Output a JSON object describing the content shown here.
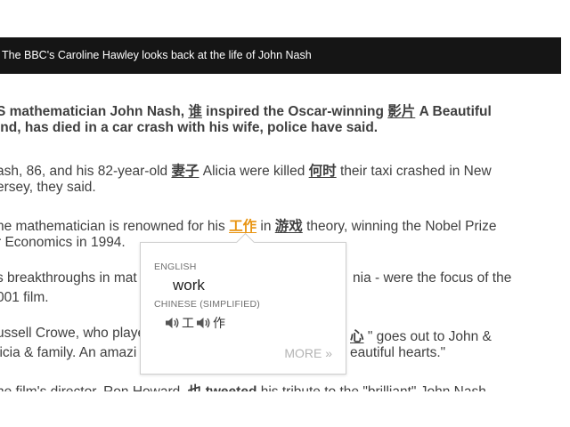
{
  "caption": "The BBC's Caroline Hawley looks back at the life of John Nash",
  "article": {
    "lead_line1": [
      "S mathematician John Nash, ",
      "谁",
      " inspired the Oscar-winning ",
      "影片",
      " A Beautiful"
    ],
    "lead_line2": "ind, has died in a car crash with his wife, police have said.",
    "p1_line1": [
      "ash, 86, and his 82-year-old ",
      "妻子",
      " Alicia were killed ",
      "何时",
      " their taxi crashed in New"
    ],
    "p1_line2": "ersey, they said.",
    "p2_line1": [
      "ne mathematician is renowned for his ",
      "工作",
      " in ",
      "游戏",
      " theory, winning the Nobel Prize"
    ],
    "p2_line2": "r Economics in 1994.",
    "p3_line1_left": "s breakthroughs in mat",
    "p3_line1_right": "nia - were the focus of the",
    "p3_line2": "001 film.",
    "p4_line1_left": "ussell Crowe, who playe",
    "p4_line1_vocab": "心",
    "p4_line1_right": " \" goes out to John &",
    "p4_line2_left": "licia & family. An amazi",
    "p4_line2_right": "eautiful hearts.\"",
    "p5_line1": [
      "he film's director, Ron Howard, ",
      "也",
      " ",
      "tweeted",
      " his tribute to the \"brilliant\" John Nash."
    ]
  },
  "popup": {
    "source_lang": "ENGLISH",
    "word": "work",
    "target_lang": "CHINESE (SIMPLIFIED)",
    "chars": [
      "工",
      "作"
    ],
    "more": "MORE »"
  },
  "colors": {
    "highlight": "#e8930f",
    "caption_bg": "#151515"
  },
  "icons": [
    "speaker-icon"
  ]
}
